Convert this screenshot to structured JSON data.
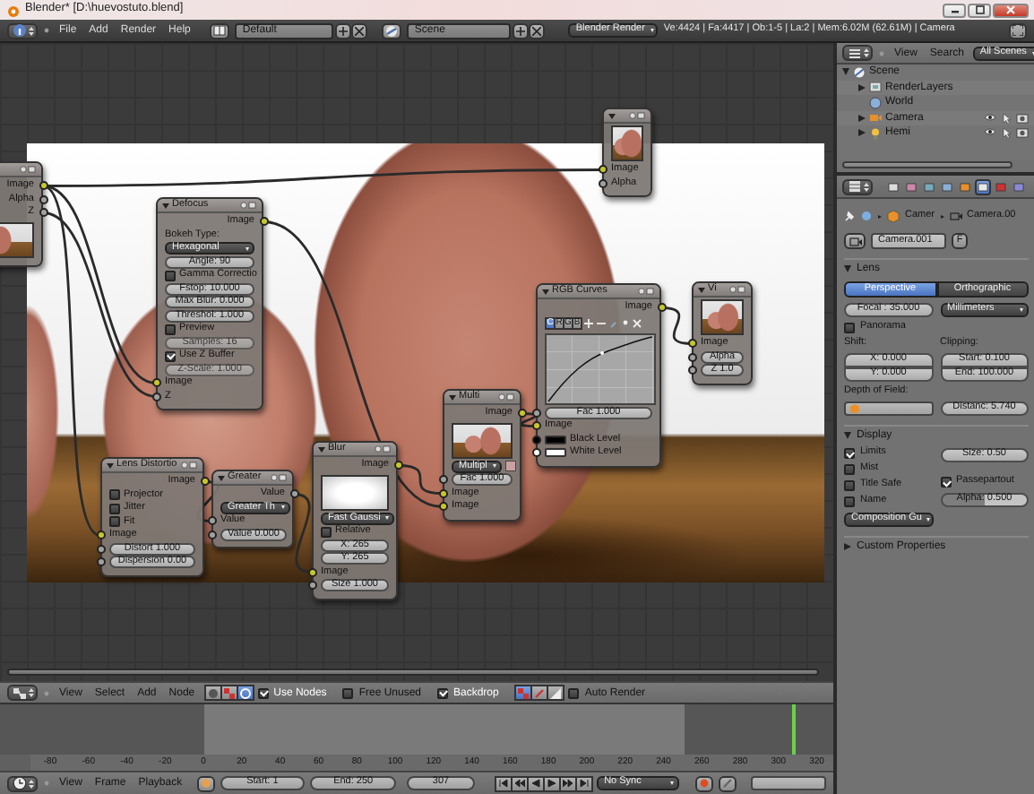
{
  "window": {
    "title": "Blender* [D:\\huevostuto.blend]"
  },
  "top_bar": {
    "menus": [
      "File",
      "Add",
      "Render",
      "Help"
    ],
    "screen_layout": "Default",
    "scene": "Scene",
    "render_engine": "Blender Render",
    "stats": "Ve:4424 | Fa:4417 | Ob:1-5 | La:2 | Mem:6.02M (62.61M) | Camera"
  },
  "node_editor": {
    "nodes": [
      {
        "rows": [
          {
            "kind": "output",
            "label": "Image",
            "color": "#c7c729"
          },
          {
            "kind": "output",
            "label": "Alpha",
            "color": "#a0a0a0"
          },
          {
            "kind": "output",
            "label": "Z",
            "color": "#a0a0a0"
          },
          {
            "kind": "preview"
          }
        ]
      },
      {
        "rows": [
          {
            "kind": "preview"
          },
          {
            "kind": "input",
            "label": "Image",
            "color": "#c7c729"
          },
          {
            "kind": "input",
            "label": "Alpha",
            "color": "#a0a0a0"
          }
        ]
      },
      {
        "title": "Defocus",
        "rows": [
          {
            "kind": "output",
            "label": "Image",
            "color": "#c7c729"
          },
          {
            "kind": "label",
            "label": "Bokeh Type:"
          },
          {
            "kind": "dropdown",
            "value": "Hexagonal"
          },
          {
            "kind": "field",
            "value": "Angle: 90",
            "disabled": false
          },
          {
            "kind": "checkbox",
            "label": "Gamma Correctio",
            "checked": false
          },
          {
            "kind": "field",
            "value": "Fstop: 10.000",
            "disabled": false
          },
          {
            "kind": "field",
            "value": "Max Blur: 0.000",
            "disabled": false
          },
          {
            "kind": "field",
            "value": "Threshol: 1.000",
            "disabled": false
          },
          {
            "kind": "checkbox",
            "label": "Preview",
            "checked": false
          },
          {
            "kind": "field",
            "value": "Samples: 16",
            "disabled": true
          },
          {
            "kind": "checkbox",
            "label": "Use Z Buffer",
            "checked": true
          },
          {
            "kind": "field",
            "value": "Z-Scale: 1.000",
            "disabled": true
          },
          {
            "kind": "input",
            "label": "Image",
            "color": "#c7c729"
          },
          {
            "kind": "input",
            "label": "Z",
            "color": "#a0a0a0"
          }
        ]
      },
      {
        "title": "Lens Distortio",
        "rows": [
          {
            "kind": "output",
            "label": "Image",
            "color": "#c7c729"
          },
          {
            "kind": "checkbox",
            "label": "Projector",
            "checked": false
          },
          {
            "kind": "checkbox",
            "label": "Jitter",
            "checked": false
          },
          {
            "kind": "checkbox",
            "label": "Fit",
            "checked": false
          },
          {
            "kind": "input",
            "label": "Image",
            "color": "#c7c729"
          },
          {
            "kind": "socket_field",
            "value": "Distort 1.000",
            "color": "#a0a0a0"
          },
          {
            "kind": "socket_field",
            "value": "Dispersion 0.00",
            "color": "#a0a0a0"
          }
        ]
      },
      {
        "title": "Greater",
        "rows": [
          {
            "kind": "output",
            "label": "Value",
            "color": "#a0a0a0"
          },
          {
            "kind": "dropdown",
            "value": "Greater Th"
          },
          {
            "kind": "input",
            "label": "Value",
            "color": "#a0a0a0"
          },
          {
            "kind": "socket_field",
            "value": "Value 0.000",
            "color": "#a0a0a0"
          }
        ]
      },
      {
        "title": "Blur",
        "rows": [
          {
            "kind": "output",
            "label": "Image",
            "color": "#c7c729"
          },
          {
            "kind": "preview"
          },
          {
            "kind": "dropdown",
            "value": "Fast Gaussi"
          },
          {
            "kind": "checkbox",
            "label": "Relative",
            "checked": false
          },
          {
            "kind": "field",
            "value": "X: 265",
            "disabled": false
          },
          {
            "kind": "field",
            "value": "Y: 265",
            "disabled": false
          },
          {
            "kind": "input",
            "label": "Image",
            "color": "#c7c729"
          },
          {
            "kind": "socket_field",
            "value": "Size 1.000",
            "color": "#a0a0a0"
          }
        ]
      },
      {
        "title": "Multi",
        "rows": [
          {
            "kind": "output",
            "label": "Image",
            "color": "#c7c729"
          },
          {
            "kind": "preview"
          },
          {
            "kind": "dropdown",
            "value": "Multipl"
          },
          {
            "kind": "socket_field",
            "value": "Fac 1.000",
            "color": "#a0a0a0"
          },
          {
            "kind": "input",
            "label": "Image",
            "color": "#c7c729"
          },
          {
            "kind": "input",
            "label": "Image",
            "color": "#c7c729"
          }
        ]
      },
      {
        "title": "RGB Curves",
        "rows": [
          {
            "kind": "output",
            "label": "Image",
            "color": "#c7c729"
          },
          {
            "kind": "channels",
            "channels": [
              {
                "label": "C",
                "selected": true
              },
              {
                "label": "R",
                "selected": false
              },
              {
                "label": "G",
                "selected": false
              },
              {
                "label": "B",
                "selected": false
              }
            ]
          },
          {
            "kind": "curve"
          },
          {
            "kind": "socket_field",
            "value": "Fac 1.000",
            "color": "#a0a0a0"
          },
          {
            "kind": "input",
            "label": "Image",
            "color": "#c7c729"
          },
          {
            "kind": "color_input",
            "label": "Black Level",
            "color": "#000000"
          },
          {
            "kind": "color_input",
            "label": "White Level",
            "color": "#ffffff"
          }
        ]
      },
      {
        "title": "Vi",
        "rows": [
          {
            "kind": "preview"
          },
          {
            "kind": "input",
            "label": "Image",
            "color": "#c7c729"
          },
          {
            "kind": "socket_field",
            "value": "Alpha",
            "color": "#a0a0a0"
          },
          {
            "kind": "socket_field",
            "value": "Z 1.0",
            "color": "#a0a0a0"
          }
        ]
      }
    ]
  },
  "node_header": {
    "menus": [
      "View",
      "Select",
      "Add",
      "Node"
    ],
    "tree_types": [
      {
        "selected": false
      },
      {
        "selected": false
      },
      {
        "selected": true
      }
    ],
    "toggles": [
      {
        "label": "Use Nodes",
        "checked": true
      },
      {
        "label": "Free Unused",
        "checked": false
      },
      {
        "label": "Backdrop",
        "checked": true
      },
      {
        "label": "Auto Render",
        "checked": false
      }
    ],
    "backdrop_channels": [
      {
        "selected": true
      },
      {
        "selected": false
      },
      {
        "selected": false
      }
    ]
  },
  "timeline": {
    "ruler": [
      "-80",
      "-60",
      "-40",
      "-20",
      "0",
      "20",
      "40",
      "60",
      "80",
      "100",
      "120",
      "140",
      "160",
      "180",
      "200",
      "220",
      "240",
      "260",
      "280",
      "300",
      "320"
    ]
  },
  "timeline_header": {
    "menus": [
      "View",
      "Frame",
      "Playback"
    ],
    "start": "Start: 1",
    "end": "End: 250",
    "current_frame": "307",
    "sync": "No Sync"
  },
  "outliner": {
    "menus": [
      "View",
      "Search"
    ],
    "filter": "All Scenes",
    "tree": [
      {
        "label": "Scene",
        "expanded": true,
        "children": [
          {
            "label": "RenderLayers",
            "expanded": false
          },
          {
            "label": "World"
          },
          {
            "label": "Camera",
            "expanded": false
          },
          {
            "label": "Hemi",
            "expanded": false
          }
        ]
      }
    ]
  },
  "properties": {
    "context_tabs": [
      {
        "selected": false
      },
      {
        "selected": false
      },
      {
        "selected": false
      },
      {
        "selected": false
      },
      {
        "selected": false
      },
      {
        "selected": true
      },
      {
        "selected": false
      },
      {
        "selected": false
      }
    ],
    "breadcrumb": [
      "Camer",
      "Camera.00"
    ],
    "datablock": "Camera.001",
    "fake_user": "F",
    "lens": {
      "title": "Lens",
      "expanded": true,
      "projection": [
        {
          "label": "Perspective",
          "selected": true
        },
        {
          "label": "Orthographic",
          "selected": false
        }
      ],
      "focal": "Focal : 35.000",
      "units": "Millimeters",
      "panorama": {
        "label": "Panorama",
        "checked": false
      },
      "shift_label": "Shift:",
      "shift": [
        "X: 0.000",
        "Y: 0.000"
      ],
      "clipping_label": "Clipping:",
      "clipping": [
        "Start: 0.100",
        "End: 100.000"
      ],
      "dof_label": "Depth of Field:",
      "dof_distance": "Distanc: 5.740"
    },
    "display": {
      "title": "Display",
      "expanded": true,
      "options": [
        {
          "label": "Limits",
          "checked": true
        },
        {
          "label": "Mist",
          "checked": false
        },
        {
          "label": "Title Safe",
          "checked": false
        },
        {
          "label": "Name",
          "checked": false
        }
      ],
      "size": "Size: 0.50",
      "passepartout": {
        "label": "Passepartout",
        "checked": true
      },
      "alpha": {
        "text": "Alpha: 0.500",
        "level": 0.5
      },
      "guides": "Composition Gu"
    },
    "custom_properties": {
      "title": "Custom Properties",
      "expanded": false
    }
  }
}
